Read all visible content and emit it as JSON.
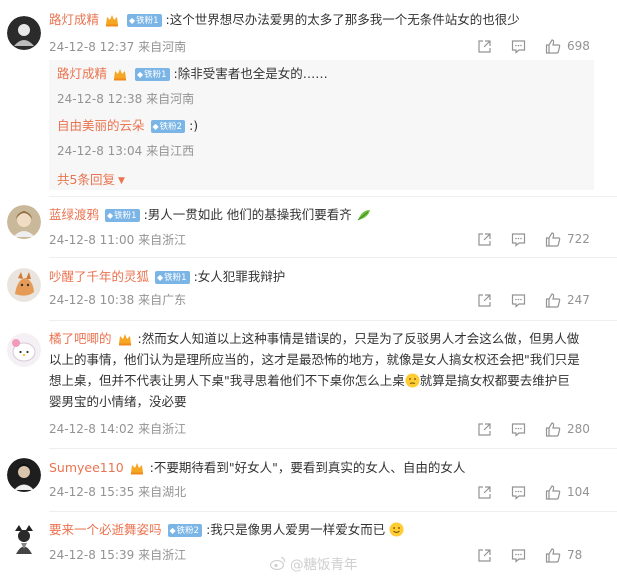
{
  "colors": {
    "username": "#eb7350",
    "meta": "#939393",
    "fan_badge": "#7ab5e6",
    "reply_bg": "#f7f7f7"
  },
  "comments": [
    {
      "username": "路灯成精",
      "fan_badge": "铁粉1",
      "text": ":这个世界想尽办法爱男的太多了那多我一个无条件站女的也很少",
      "time": "24-12-8 12:37",
      "location": "来自河南",
      "likes": "698",
      "replies": [
        {
          "username": "路灯成精",
          "fan_badge": "铁粉1",
          "text": ":除非受害者也全是女的……",
          "time": "24-12-8 12:38",
          "location": "来自河南"
        },
        {
          "username": "自由美丽的云朵",
          "fan_badge": "铁粉2",
          "text": ":)",
          "time": "24-12-8 13:04",
          "location": "来自江西"
        }
      ],
      "more_replies": "共5条回复"
    },
    {
      "username": "蓝绿渡鸦",
      "fan_badge": "铁粉1",
      "text": ":男人一贯如此 他们的基操我们要看齐",
      "time": "24-12-8 11:00",
      "location": "来自浙江",
      "likes": "722"
    },
    {
      "username": "吵醒了千年的灵狐",
      "fan_badge": "铁粉1",
      "text": ":女人犯罪我辩护",
      "time": "24-12-8 10:38",
      "location": "来自广东",
      "likes": "247"
    },
    {
      "username": "橘了吧唧的",
      "text_line1": ":然而女人知道以上这种事情是错误的，只是为了反驳男人才会这么做，但男人做",
      "text_line2": "以上的事情，他们认为是理所应当的，这才是最恐怖的地方，就像是女人搞女权还会把\"我们只是",
      "text_line3a": "想上桌，但并不代表让男人下桌\"我寻思着他们不下桌你怎么上桌",
      "text_line3b": "就算是搞女权都要去维护巨",
      "text_line4": "婴男宝的小情绪，没必要",
      "time": "24-12-8 14:02",
      "location": "来自浙江",
      "likes": "280"
    },
    {
      "username": "Sumyee110",
      "text": ":不要期待看到\"好女人\"，要看到真实的女人、自由的女人",
      "time": "24-12-8 15:35",
      "location": "来自湖北",
      "likes": "104"
    },
    {
      "username": "要来一个必逝舞姿吗",
      "fan_badge": "铁粉2",
      "text": ":我只是像男人爱男一样爱女而已",
      "time": "24-12-8 15:39",
      "location": "来自浙江",
      "likes": "78"
    }
  ],
  "watermark": "@糖饭青年"
}
